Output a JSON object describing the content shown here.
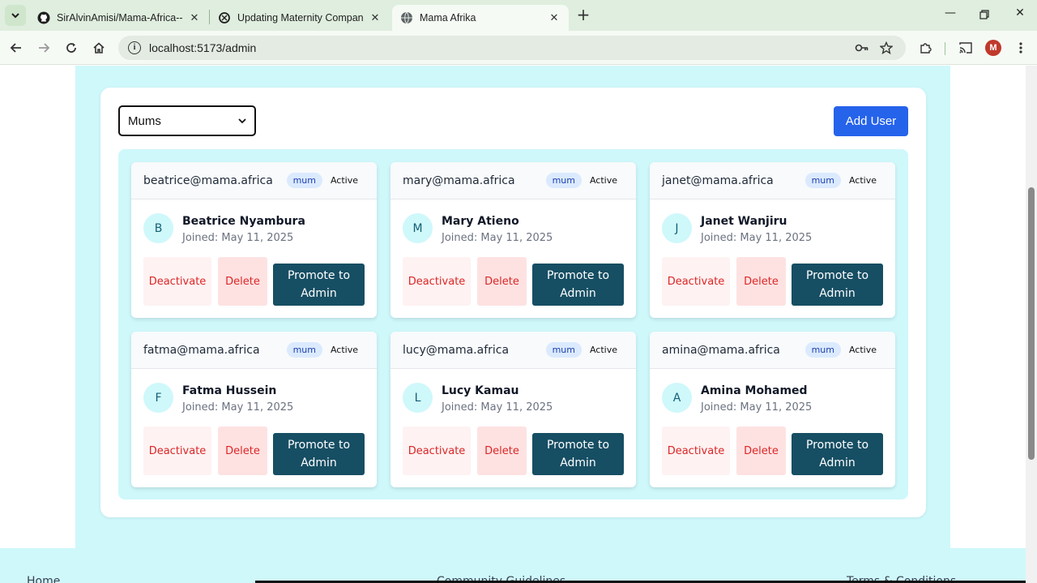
{
  "browser": {
    "tabs": [
      {
        "title": "SirAlvinAmisi/Mama-Africa---M",
        "icon": "github-icon",
        "active": false
      },
      {
        "title": "Updating Maternity Companion",
        "icon": "openai-icon",
        "active": false
      },
      {
        "title": "Mama Afrika",
        "icon": "globe-icon",
        "active": true
      }
    ],
    "url": "localhost:5173/admin",
    "profile_initial": "M"
  },
  "admin": {
    "role_filter": {
      "selected": "Mums"
    },
    "add_user_label": "Add User",
    "users": [
      {
        "email": "beatrice@mama.africa",
        "role": "mum",
        "status": "Active",
        "initial": "B",
        "name": "Beatrice Nyambura",
        "joined": "Joined: May 11, 2025",
        "deactivate": "Deactivate",
        "delete": "Delete",
        "promote": "Promote to Admin"
      },
      {
        "email": "mary@mama.africa",
        "role": "mum",
        "status": "Active",
        "initial": "M",
        "name": "Mary Atieno",
        "joined": "Joined: May 11, 2025",
        "deactivate": "Deactivate",
        "delete": "Delete",
        "promote": "Promote to Admin"
      },
      {
        "email": "janet@mama.africa",
        "role": "mum",
        "status": "Active",
        "initial": "J",
        "name": "Janet Wanjiru",
        "joined": "Joined: May 11, 2025",
        "deactivate": "Deactivate",
        "delete": "Delete",
        "promote": "Promote to Admin"
      },
      {
        "email": "fatma@mama.africa",
        "role": "mum",
        "status": "Active",
        "initial": "F",
        "name": "Fatma Hussein",
        "joined": "Joined: May 11, 2025",
        "deactivate": "Deactivate",
        "delete": "Delete",
        "promote": "Promote to Admin"
      },
      {
        "email": "lucy@mama.africa",
        "role": "mum",
        "status": "Active",
        "initial": "L",
        "name": "Lucy Kamau",
        "joined": "Joined: May 11, 2025",
        "deactivate": "Deactivate",
        "delete": "Delete",
        "promote": "Promote to Admin"
      },
      {
        "email": "amina@mama.africa",
        "role": "mum",
        "status": "Active",
        "initial": "A",
        "name": "Amina Mohamed",
        "joined": "Joined: May 11, 2025",
        "deactivate": "Deactivate",
        "delete": "Delete",
        "promote": "Promote to Admin"
      }
    ]
  },
  "footer": {
    "links": [
      "Home",
      "Community Guidelines",
      "Terms & Conditions"
    ]
  },
  "colors": {
    "accent": "#2563eb",
    "page_bg": "#cff8fb",
    "promote_bg": "#164e63",
    "danger": "#dc2626"
  }
}
